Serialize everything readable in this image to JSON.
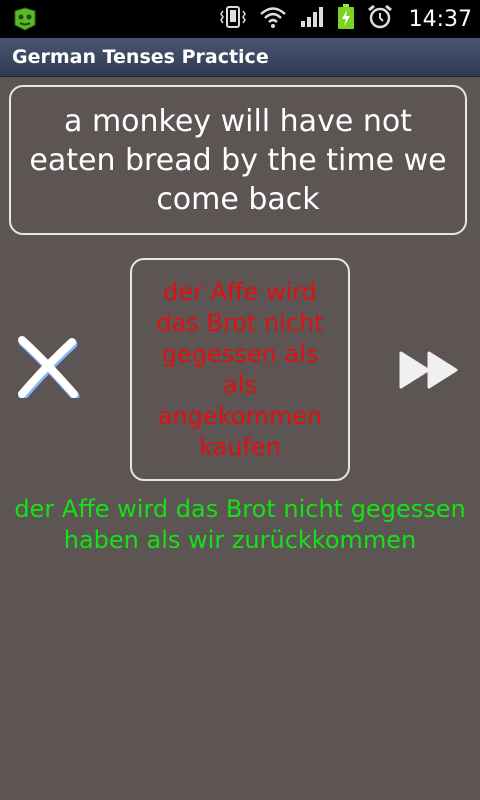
{
  "status_bar": {
    "time": "14:37",
    "icons": [
      "app-notification-icon",
      "vibrate-icon",
      "wifi-icon",
      "signal-icon",
      "battery-charging-icon",
      "alarm-icon"
    ]
  },
  "app": {
    "title": "German Tenses Practice"
  },
  "quiz": {
    "question": "a monkey will have not eaten bread by the time we come back",
    "user_answer": "der Affe wird das Brot nicht gegessen als als angekommen kaufen",
    "correct_answer": "der Affe wird das Brot nicht gegessen haben als wir zurückkommen"
  },
  "colors": {
    "background": "#5d5454",
    "user_answer_text": "#e01010",
    "correct_answer_text": "#16e016",
    "title_bar": "#3b4660"
  }
}
